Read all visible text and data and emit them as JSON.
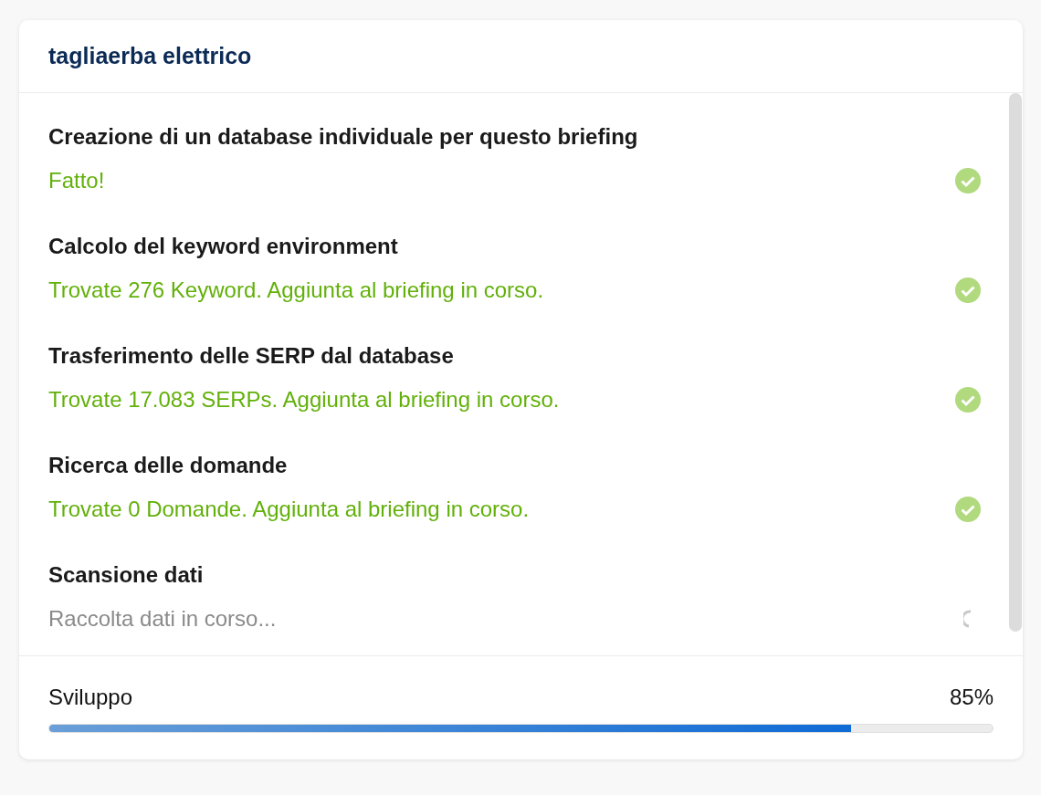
{
  "title": "tagliaerba elettrico",
  "steps": [
    {
      "label": "Creazione di un database individuale per questo briefing",
      "status": "Fatto!",
      "kind": "done"
    },
    {
      "label": "Calcolo del keyword environment",
      "status": "Trovate 276 Keyword. Aggiunta al briefing in corso.",
      "kind": "done"
    },
    {
      "label": "Trasferimento delle SERP dal database",
      "status": "Trovate 17.083 SERPs. Aggiunta al briefing in corso.",
      "kind": "done"
    },
    {
      "label": "Ricerca delle domande",
      "status": "Trovate 0 Domande. Aggiunta al briefing in corso.",
      "kind": "done"
    },
    {
      "label": "Scansione dati",
      "status": "Raccolta dati in corso...",
      "kind": "running"
    }
  ],
  "progress": {
    "label": "Sviluppo",
    "reading": "85%",
    "level": 0.85
  }
}
